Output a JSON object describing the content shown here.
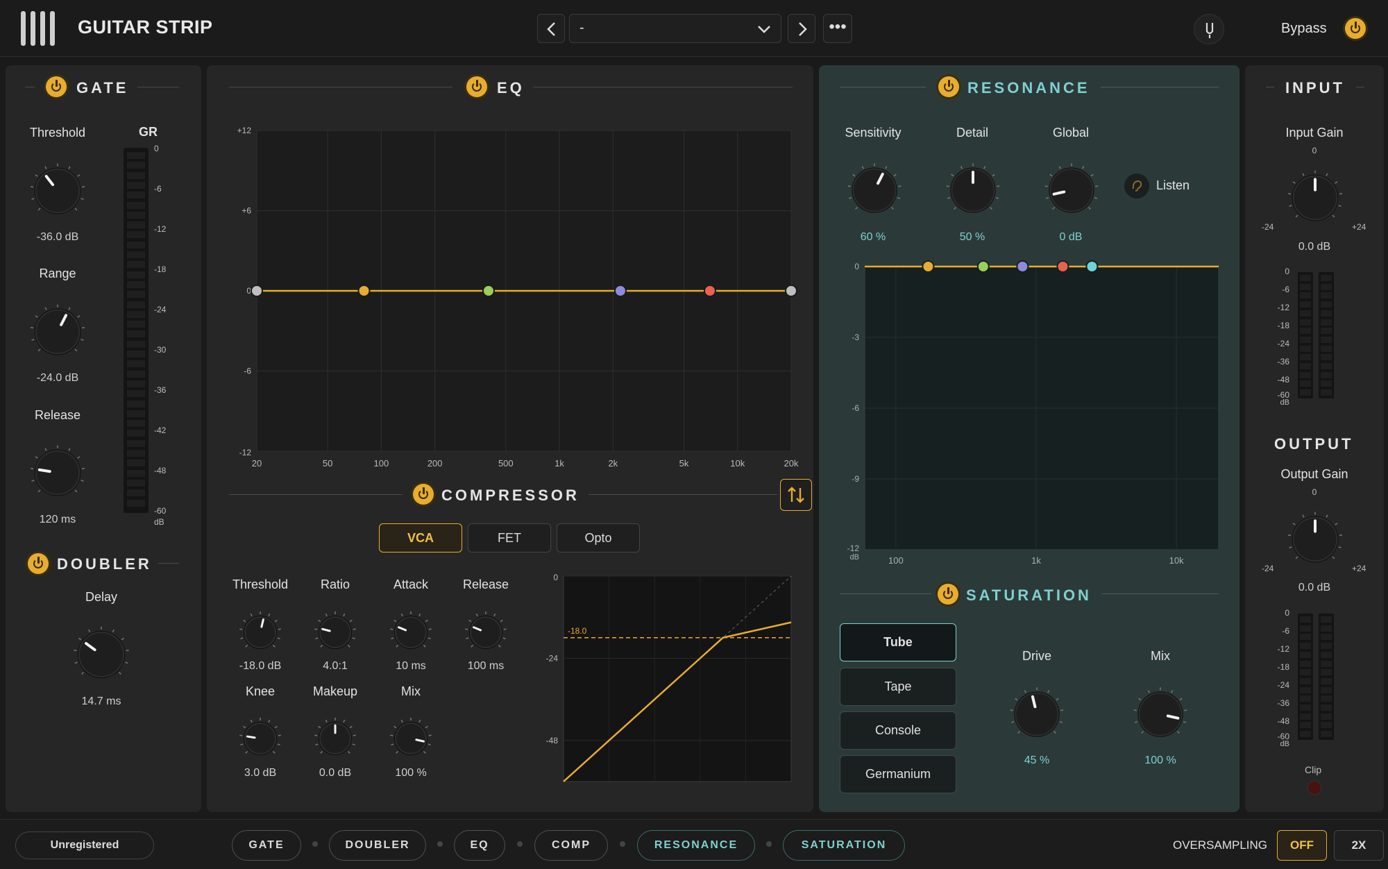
{
  "header": {
    "title": "GUITAR STRIP",
    "preset_name": "-",
    "more_label": "•••",
    "bypass_label": "Bypass"
  },
  "gate": {
    "title": "GATE",
    "gr_label": "GR",
    "threshold": {
      "label": "Threshold",
      "value": "-36.0 dB",
      "level": 0.36
    },
    "range": {
      "label": "Range",
      "value": "-24.0 dB",
      "level": 0.6
    },
    "release": {
      "label": "Release",
      "value": "120 ms",
      "level": 0.2
    },
    "gr_ticks": [
      "0",
      "-6",
      "-12",
      "-18",
      "-24",
      "-30",
      "-36",
      "-42",
      "-48",
      "-60",
      "dB"
    ]
  },
  "doubler": {
    "title": "DOUBLER",
    "delay": {
      "label": "Delay",
      "value": "14.7 ms",
      "level": 0.3
    }
  },
  "eq": {
    "title": "EQ",
    "y_ticks": [
      "+12",
      "+6",
      "0",
      "-6",
      "-12"
    ],
    "x_ticks": [
      "20",
      "50",
      "100",
      "200",
      "500",
      "1k",
      "2k",
      "5k",
      "10k",
      "20k"
    ],
    "nodes": [
      {
        "freq_hz": 20,
        "gain_db": 0,
        "color": "#bfbfbf"
      },
      {
        "freq_hz": 80,
        "gain_db": 0,
        "color": "#e7ad2e"
      },
      {
        "freq_hz": 400,
        "gain_db": 0,
        "color": "#9bcf5a"
      },
      {
        "freq_hz": 2200,
        "gain_db": 0,
        "color": "#8f8ae0"
      },
      {
        "freq_hz": 7000,
        "gain_db": 0,
        "color": "#e8624e"
      },
      {
        "freq_hz": 20000,
        "gain_db": 0,
        "color": "#bfbfbf"
      }
    ]
  },
  "compressor": {
    "title": "COMPRESSOR",
    "modes": [
      "VCA",
      "FET",
      "Opto"
    ],
    "active_mode": "VCA",
    "threshold": {
      "label": "Threshold",
      "value": "-18.0 dB",
      "level": 0.55
    },
    "ratio": {
      "label": "Ratio",
      "value": "4.0:1",
      "level": 0.22
    },
    "attack": {
      "label": "Attack",
      "value": "10 ms",
      "level": 0.25
    },
    "release": {
      "label": "Release",
      "value": "100 ms",
      "level": 0.25
    },
    "knee": {
      "label": "Knee",
      "value": "3.0 dB",
      "level": 0.2
    },
    "makeup": {
      "label": "Makeup",
      "value": "0.0 dB",
      "level": 0.5
    },
    "mix": {
      "label": "Mix",
      "value": "100 %",
      "level": 0.88
    },
    "graph": {
      "y_ticks": [
        "0",
        "-24",
        "-48"
      ],
      "threshold_label": "-18.0"
    }
  },
  "resonance": {
    "title": "RESONANCE",
    "listen_label": "Listen",
    "sensitivity": {
      "label": "Sensitivity",
      "value": "60 %",
      "level": 0.6
    },
    "detail": {
      "label": "Detail",
      "value": "50 %",
      "level": 0.5
    },
    "global": {
      "label": "Global",
      "value": "0 dB",
      "level": 0.12
    },
    "y_ticks": [
      "0",
      "-3",
      "-6",
      "-9",
      "-12",
      "dB"
    ],
    "x_ticks": [
      "100",
      "1k",
      "10k"
    ],
    "nodes": [
      {
        "freq_hz": 170,
        "color": "#e7ad2e"
      },
      {
        "freq_hz": 420,
        "color": "#9bcf5a"
      },
      {
        "freq_hz": 800,
        "color": "#8f8ae0"
      },
      {
        "freq_hz": 1550,
        "color": "#e8624e"
      },
      {
        "freq_hz": 2500,
        "color": "#6fd4d6"
      }
    ]
  },
  "saturation": {
    "title": "SATURATION",
    "types": [
      "Tube",
      "Tape",
      "Console",
      "Germanium"
    ],
    "active_type": "Tube",
    "drive": {
      "label": "Drive",
      "value": "45 %",
      "level": 0.45
    },
    "mix": {
      "label": "Mix",
      "value": "100 %",
      "level": 0.88
    }
  },
  "input": {
    "title": "INPUT",
    "gain": {
      "label": "Input Gain",
      "value": "0.0 dB",
      "level": 0.5
    },
    "scale_top": "0",
    "scale_min": "-24",
    "scale_max": "+24",
    "meter_ticks": [
      "0",
      "-6",
      "-12",
      "-18",
      "-24",
      "-36",
      "-48",
      "-60",
      "dB"
    ]
  },
  "output": {
    "title": "OUTPUT",
    "gain": {
      "label": "Output Gain",
      "value": "0.0 dB",
      "level": 0.5
    },
    "scale_top": "0",
    "scale_min": "-24",
    "scale_max": "+24",
    "meter_ticks": [
      "0",
      "-6",
      "-12",
      "-18",
      "-24",
      "-36",
      "-48",
      "-60",
      "dB"
    ],
    "clip_label": "Clip"
  },
  "footer": {
    "registration": "Unregistered",
    "chain": [
      "GATE",
      "DOUBLER",
      "EQ",
      "COMP",
      "RESONANCE",
      "SATURATION"
    ],
    "oversampling_label": "OVERSAMPLING",
    "oversampling_options": [
      "OFF",
      "2X"
    ],
    "oversampling_active": "OFF"
  },
  "colors": {
    "accent": "#e7ad2e",
    "teal": "#7fd0cf"
  }
}
